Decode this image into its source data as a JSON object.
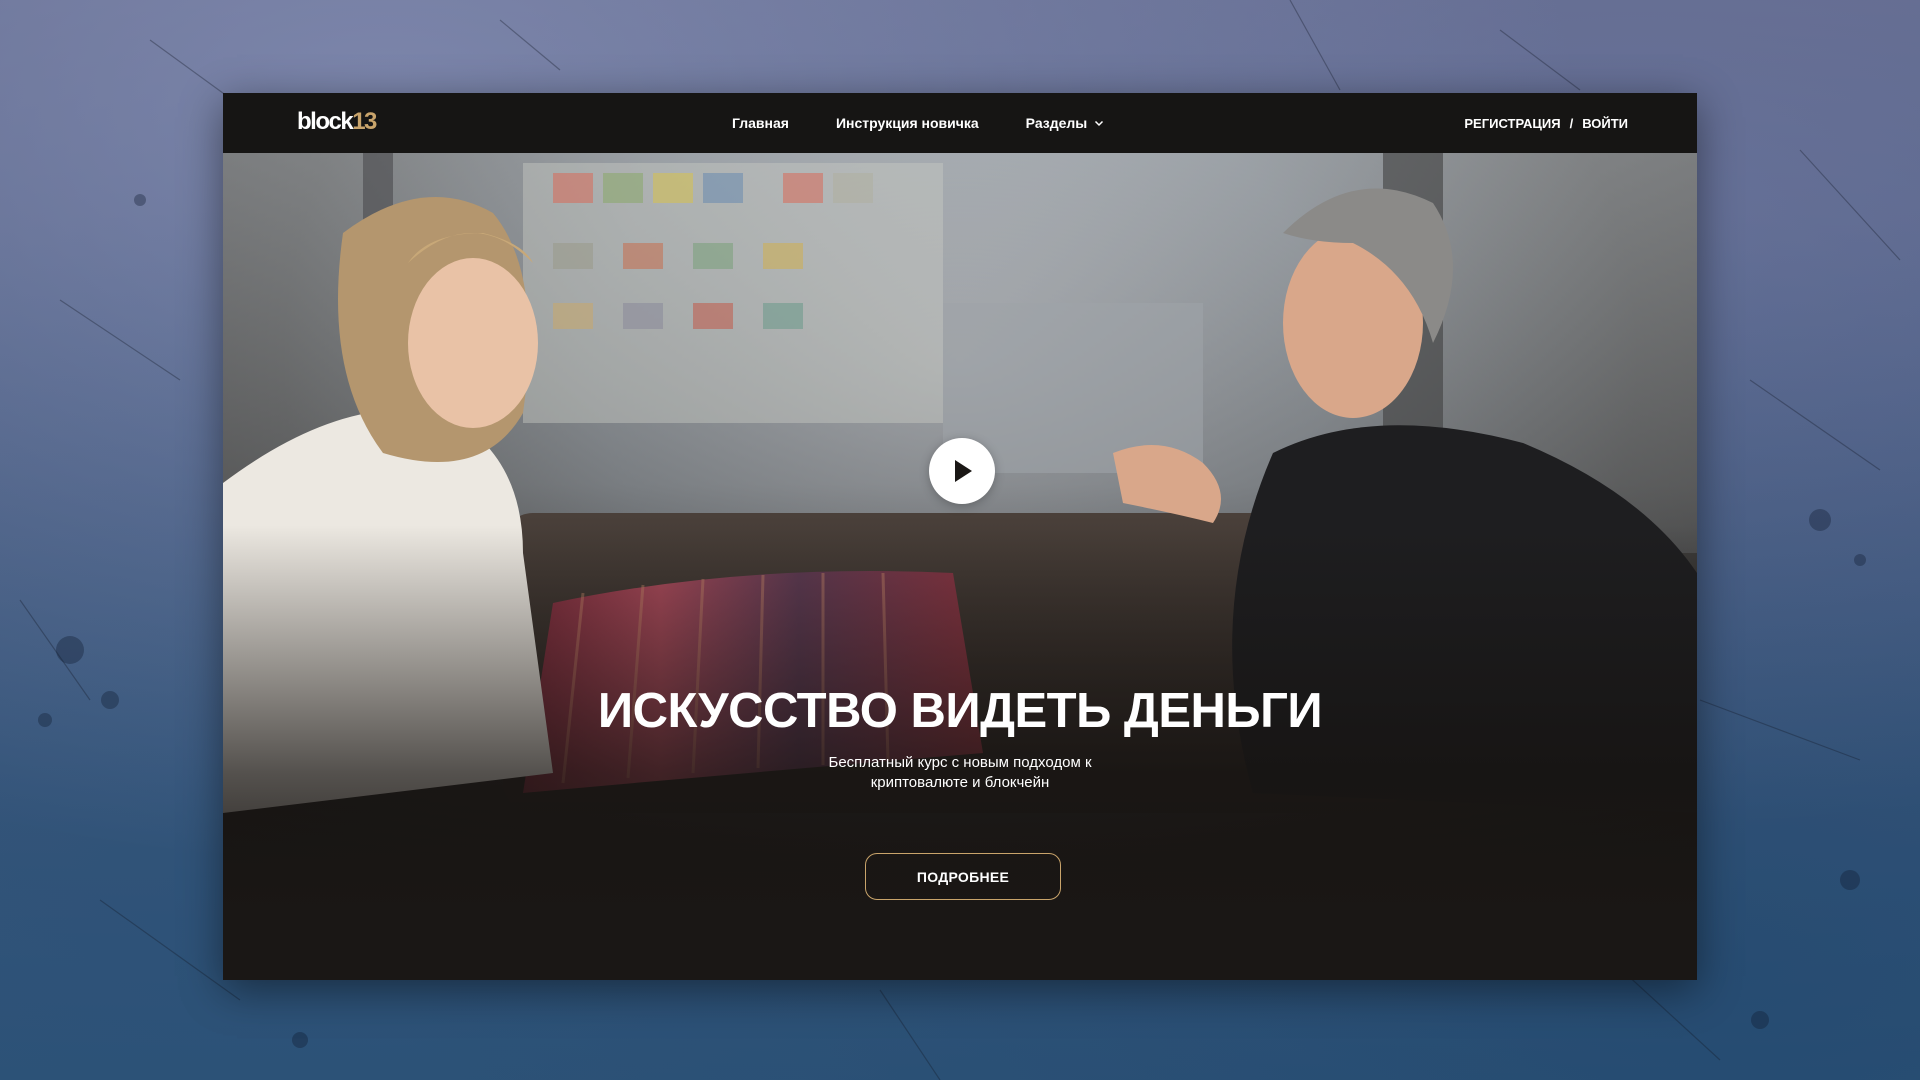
{
  "logo": {
    "text": "block",
    "number": "13"
  },
  "nav": {
    "items": [
      {
        "label": "Главная"
      },
      {
        "label": "Инструкция новичка"
      },
      {
        "label": "Разделы"
      }
    ]
  },
  "auth": {
    "register": "РЕГИСТРАЦИЯ",
    "separator": "/",
    "login": "ВОЙТИ"
  },
  "hero": {
    "title": "ИСКУССТВО ВИДЕТЬ ДЕНЬГИ",
    "subtitle_line1": "Бесплатный курс с новым подходом к",
    "subtitle_line2": "криптовалюте и блокчейн",
    "cta_label": "ПОДРОБНЕЕ"
  },
  "colors": {
    "accent": "#c9a46b",
    "navbar": "#161514",
    "text": "#ffffff"
  },
  "icons": [
    "play-icon",
    "chevron-down-icon"
  ]
}
